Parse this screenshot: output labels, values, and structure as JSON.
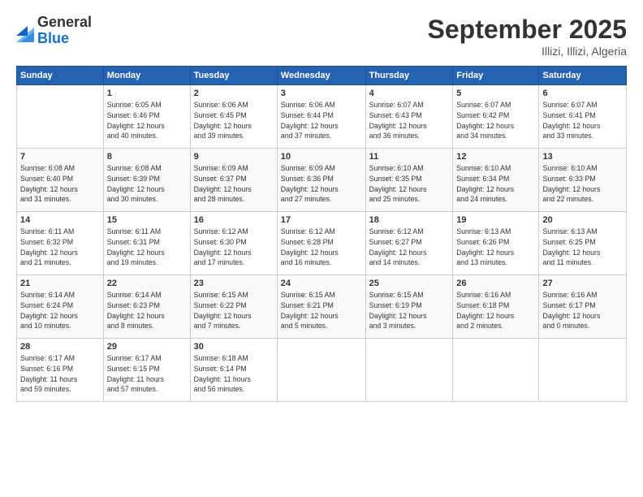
{
  "header": {
    "logo": {
      "general": "General",
      "blue": "Blue"
    },
    "title": "September 2025",
    "subtitle": "Illizi, Illizi, Algeria"
  },
  "calendar": {
    "headers": [
      "Sunday",
      "Monday",
      "Tuesday",
      "Wednesday",
      "Thursday",
      "Friday",
      "Saturday"
    ],
    "weeks": [
      [
        {
          "day": "",
          "info": ""
        },
        {
          "day": "1",
          "info": "Sunrise: 6:05 AM\nSunset: 6:46 PM\nDaylight: 12 hours\nand 40 minutes."
        },
        {
          "day": "2",
          "info": "Sunrise: 6:06 AM\nSunset: 6:45 PM\nDaylight: 12 hours\nand 39 minutes."
        },
        {
          "day": "3",
          "info": "Sunrise: 6:06 AM\nSunset: 6:44 PM\nDaylight: 12 hours\nand 37 minutes."
        },
        {
          "day": "4",
          "info": "Sunrise: 6:07 AM\nSunset: 6:43 PM\nDaylight: 12 hours\nand 36 minutes."
        },
        {
          "day": "5",
          "info": "Sunrise: 6:07 AM\nSunset: 6:42 PM\nDaylight: 12 hours\nand 34 minutes."
        },
        {
          "day": "6",
          "info": "Sunrise: 6:07 AM\nSunset: 6:41 PM\nDaylight: 12 hours\nand 33 minutes."
        }
      ],
      [
        {
          "day": "7",
          "info": "Sunrise: 6:08 AM\nSunset: 6:40 PM\nDaylight: 12 hours\nand 31 minutes."
        },
        {
          "day": "8",
          "info": "Sunrise: 6:08 AM\nSunset: 6:39 PM\nDaylight: 12 hours\nand 30 minutes."
        },
        {
          "day": "9",
          "info": "Sunrise: 6:09 AM\nSunset: 6:37 PM\nDaylight: 12 hours\nand 28 minutes."
        },
        {
          "day": "10",
          "info": "Sunrise: 6:09 AM\nSunset: 6:36 PM\nDaylight: 12 hours\nand 27 minutes."
        },
        {
          "day": "11",
          "info": "Sunrise: 6:10 AM\nSunset: 6:35 PM\nDaylight: 12 hours\nand 25 minutes."
        },
        {
          "day": "12",
          "info": "Sunrise: 6:10 AM\nSunset: 6:34 PM\nDaylight: 12 hours\nand 24 minutes."
        },
        {
          "day": "13",
          "info": "Sunrise: 6:10 AM\nSunset: 6:33 PM\nDaylight: 12 hours\nand 22 minutes."
        }
      ],
      [
        {
          "day": "14",
          "info": "Sunrise: 6:11 AM\nSunset: 6:32 PM\nDaylight: 12 hours\nand 21 minutes."
        },
        {
          "day": "15",
          "info": "Sunrise: 6:11 AM\nSunset: 6:31 PM\nDaylight: 12 hours\nand 19 minutes."
        },
        {
          "day": "16",
          "info": "Sunrise: 6:12 AM\nSunset: 6:30 PM\nDaylight: 12 hours\nand 17 minutes."
        },
        {
          "day": "17",
          "info": "Sunrise: 6:12 AM\nSunset: 6:28 PM\nDaylight: 12 hours\nand 16 minutes."
        },
        {
          "day": "18",
          "info": "Sunrise: 6:12 AM\nSunset: 6:27 PM\nDaylight: 12 hours\nand 14 minutes."
        },
        {
          "day": "19",
          "info": "Sunrise: 6:13 AM\nSunset: 6:26 PM\nDaylight: 12 hours\nand 13 minutes."
        },
        {
          "day": "20",
          "info": "Sunrise: 6:13 AM\nSunset: 6:25 PM\nDaylight: 12 hours\nand 11 minutes."
        }
      ],
      [
        {
          "day": "21",
          "info": "Sunrise: 6:14 AM\nSunset: 6:24 PM\nDaylight: 12 hours\nand 10 minutes."
        },
        {
          "day": "22",
          "info": "Sunrise: 6:14 AM\nSunset: 6:23 PM\nDaylight: 12 hours\nand 8 minutes."
        },
        {
          "day": "23",
          "info": "Sunrise: 6:15 AM\nSunset: 6:22 PM\nDaylight: 12 hours\nand 7 minutes."
        },
        {
          "day": "24",
          "info": "Sunrise: 6:15 AM\nSunset: 6:21 PM\nDaylight: 12 hours\nand 5 minutes."
        },
        {
          "day": "25",
          "info": "Sunrise: 6:15 AM\nSunset: 6:19 PM\nDaylight: 12 hours\nand 3 minutes."
        },
        {
          "day": "26",
          "info": "Sunrise: 6:16 AM\nSunset: 6:18 PM\nDaylight: 12 hours\nand 2 minutes."
        },
        {
          "day": "27",
          "info": "Sunrise: 6:16 AM\nSunset: 6:17 PM\nDaylight: 12 hours\nand 0 minutes."
        }
      ],
      [
        {
          "day": "28",
          "info": "Sunrise: 6:17 AM\nSunset: 6:16 PM\nDaylight: 11 hours\nand 59 minutes."
        },
        {
          "day": "29",
          "info": "Sunrise: 6:17 AM\nSunset: 6:15 PM\nDaylight: 11 hours\nand 57 minutes."
        },
        {
          "day": "30",
          "info": "Sunrise: 6:18 AM\nSunset: 6:14 PM\nDaylight: 11 hours\nand 56 minutes."
        },
        {
          "day": "",
          "info": ""
        },
        {
          "day": "",
          "info": ""
        },
        {
          "day": "",
          "info": ""
        },
        {
          "day": "",
          "info": ""
        }
      ]
    ]
  }
}
